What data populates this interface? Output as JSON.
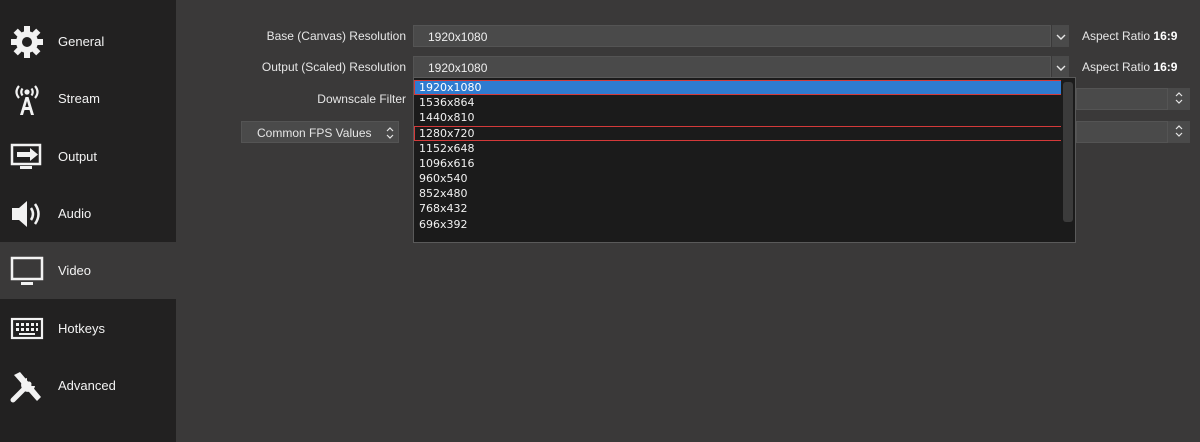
{
  "sidebar": {
    "items": [
      {
        "label": "General",
        "icon": "gear-icon"
      },
      {
        "label": "Stream",
        "icon": "broadcast-icon"
      },
      {
        "label": "Output",
        "icon": "output-icon"
      },
      {
        "label": "Audio",
        "icon": "speaker-icon"
      },
      {
        "label": "Video",
        "icon": "monitor-icon",
        "active": true
      },
      {
        "label": "Hotkeys",
        "icon": "keyboard-icon"
      },
      {
        "label": "Advanced",
        "icon": "tools-icon"
      }
    ]
  },
  "video": {
    "base_label": "Base (Canvas) Resolution",
    "base_value": "1920x1080",
    "base_aspect_prefix": "Aspect Ratio",
    "base_aspect_value": "16:9",
    "output_label": "Output (Scaled) Resolution",
    "output_value": "1920x1080",
    "output_aspect_prefix": "Aspect Ratio",
    "output_aspect_value": "16:9",
    "downscale_label": "Downscale Filter",
    "fps_label": "Common FPS Values"
  },
  "dropdown": {
    "options": [
      "1920x1080",
      "1536x864",
      "1440x810",
      "1280x720",
      "1152x648",
      "1096x616",
      "960x540",
      "852x480",
      "768x432",
      "696x392"
    ],
    "selected": "1920x1080",
    "highlighted": [
      "1920x1080",
      "1280x720"
    ]
  },
  "colors": {
    "background": "#3a3939",
    "sidebar": "#222121",
    "selection": "#2f7bd0",
    "highlight_box": "#d43a3a"
  }
}
